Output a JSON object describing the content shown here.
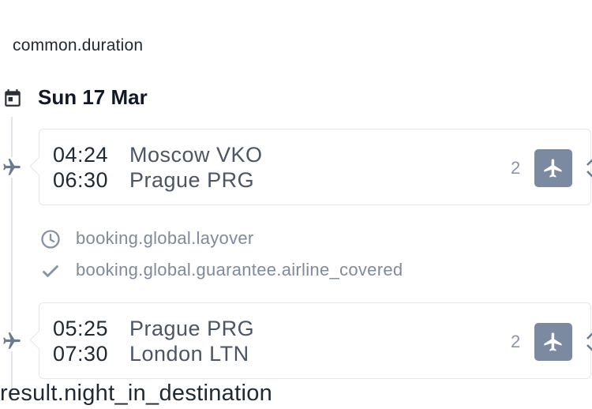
{
  "trip": {
    "duration_label": "common.duration",
    "date": "Sun 17 Mar",
    "segments": [
      {
        "dep_time": "04:24",
        "dep_place": "Moscow VKO",
        "arr_time": "06:30",
        "arr_place": "Prague PRG",
        "count": "2",
        "icon": "airplane-icon"
      },
      {
        "dep_time": "05:25",
        "dep_place": "Prague PRG",
        "arr_time": "07:30",
        "arr_place": "London LTN",
        "count": "2",
        "icon": "airplane-icon"
      }
    ],
    "layover": {
      "layover_label": "booking.global.layover",
      "guarantee_label": "booking.global.guarantee.airline_covered"
    },
    "night_label": "result.night_in_destination"
  },
  "colors": {
    "accent": "#7b8aa1",
    "muted_text": "#7f8a9b",
    "border": "#e3e6ea",
    "icon": "#6b7a90"
  }
}
